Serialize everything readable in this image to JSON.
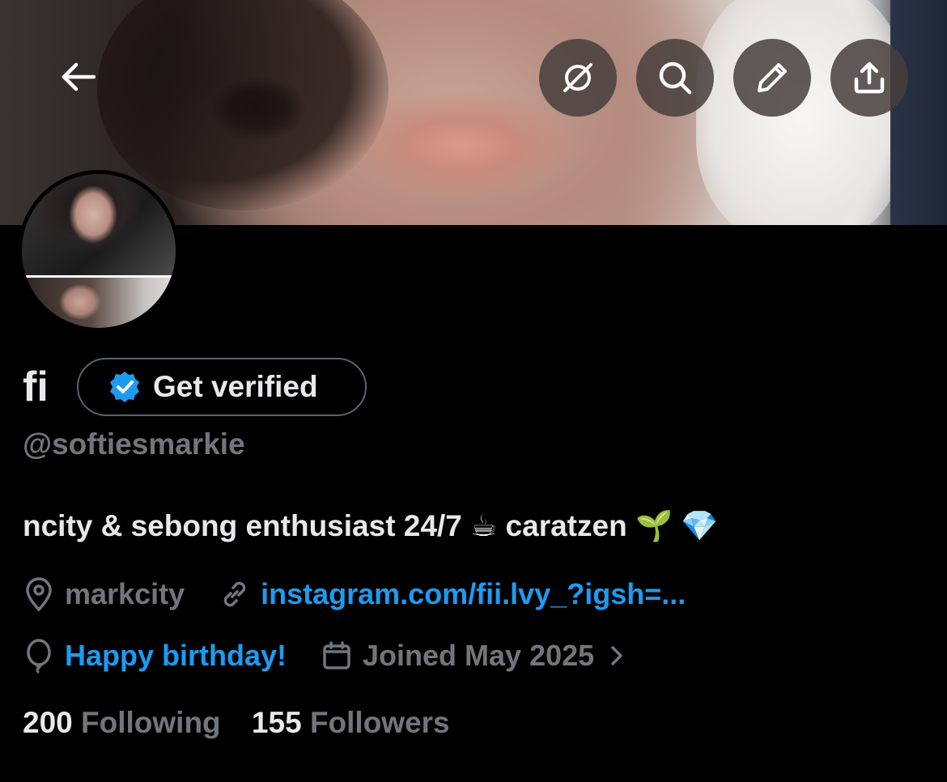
{
  "header": {
    "back_icon": "arrow-left-icon",
    "actions": [
      "grok-icon",
      "search-icon",
      "edit-icon",
      "share-icon"
    ]
  },
  "profile": {
    "display_name": "fi",
    "verify_label": "Get verified",
    "handle": "@softiesmarkie",
    "bio": "ncity & sebong enthusiast 24/7 ☕ caratzen 🌱 💎",
    "location": "markcity",
    "website": "instagram.com/fii.lvy_?igsh=...",
    "birthday": "Happy birthday!",
    "joined": "Joined May 2025",
    "following_count": "200",
    "following_label": "Following",
    "followers_count": "155",
    "followers_label": "Followers"
  },
  "colors": {
    "background": "#000000",
    "text": "#e7e9ea",
    "secondary": "#71767b",
    "link": "#1d9bf0",
    "verified": "#1d9bf0"
  }
}
